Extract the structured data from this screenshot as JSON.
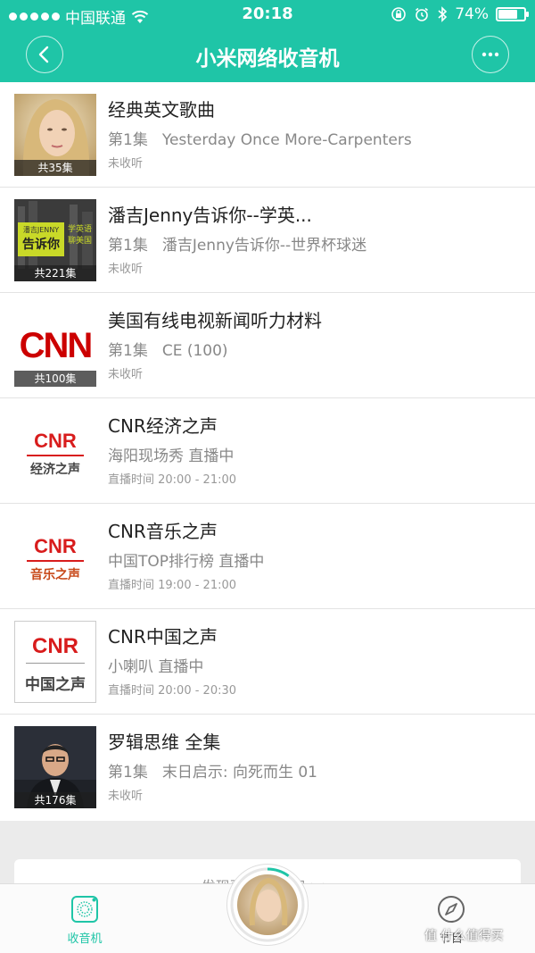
{
  "status": {
    "carrier": "中国联通",
    "time": "20:18",
    "battery": "74%",
    "battery_level": 0.74
  },
  "header": {
    "title": "小米网络收音机"
  },
  "items": [
    {
      "title": "经典英文歌曲",
      "episode": "第1集",
      "subtitle": "Yesterday Once More-Carpenters",
      "meta": "未收听",
      "count": "共35集"
    },
    {
      "title": "潘吉Jenny告诉你--学英...",
      "episode": "第1集",
      "subtitle": "潘吉Jenny告诉你--世界杯球迷",
      "meta": "未收听",
      "count": "共221集",
      "thumb_text": {
        "line1": "潘吉JENNY",
        "line2": "告诉你",
        "line3": "学英语",
        "line4": "聊美国"
      }
    },
    {
      "title": "美国有线电视新闻听力材料",
      "episode": "第1集",
      "subtitle": "CE (100)",
      "meta": "未收听",
      "count": "共100集",
      "logo": "CNN"
    },
    {
      "title": "CNR经济之声",
      "subtitle": "海阳现场秀 直播中",
      "meta": "直播时间 20:00 - 21:00",
      "logo": "CNR",
      "logo_sub": "经济之声"
    },
    {
      "title": "CNR音乐之声",
      "subtitle": "中国TOP排行榜 直播中",
      "meta": "直播时间 19:00 - 21:00",
      "logo": "CNR",
      "logo_sub": "音乐之声"
    },
    {
      "title": "CNR中国之声",
      "subtitle": "小喇叭 直播中",
      "meta": "直播时间 20:00 - 20:30",
      "logo": "CNR",
      "logo_sub": "中国之声"
    },
    {
      "title": "罗辑思维 全集",
      "episode": "第1集",
      "subtitle": "末日启示: 向死而生 01",
      "meta": "未收听",
      "count": "共176集"
    }
  ],
  "discover": {
    "label": "发现更多... 内容 >>"
  },
  "tabs": {
    "radio": "收音机",
    "discover": "节目"
  },
  "player": {
    "progress": 0.1
  },
  "watermark": "值 什么值得买",
  "colors": {
    "accent": "#1fc5a7",
    "cnn_red": "#cc0000",
    "cnr_red": "#d81c1c"
  }
}
